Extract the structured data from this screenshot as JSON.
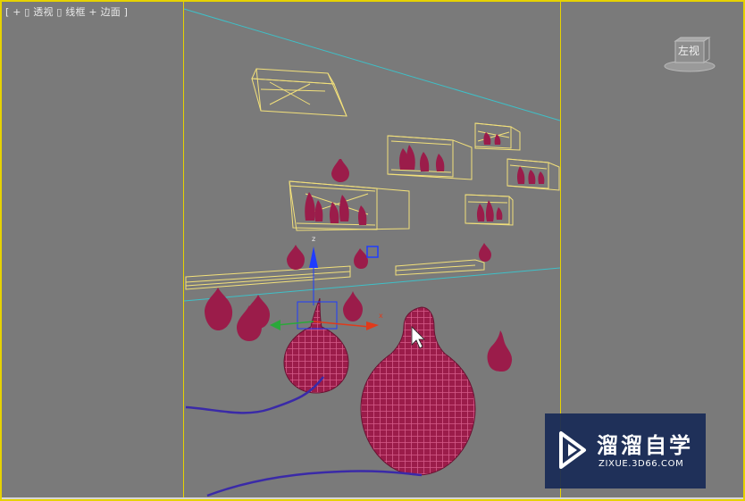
{
  "viewport": {
    "label_parts": [
      "[ + ]",
      "[ 透视 ]",
      "[ 线框 + 边面 ]"
    ],
    "label_text": "[ + ▯ 透视 ▯ 线框 + 边面 ]",
    "active_border_color": "#e6d200"
  },
  "viewcube": {
    "label": "左视",
    "icon": "viewcube-icon"
  },
  "gizmo": {
    "axis_x": "x",
    "axis_z": "z",
    "colors": {
      "x": "#e03a1a",
      "y": "#2aa83a",
      "z": "#1f3cff"
    }
  },
  "colors": {
    "vase": "#9b1c4a",
    "vase_wire": "#c44878",
    "shelf_wire": "#f2e07a",
    "spline": "#3a2aa8",
    "grid_line": "#3ec0c8"
  },
  "watermark": {
    "title": "溜溜自学",
    "url": "ZIXUE.3D66.COM",
    "icon": "play-logo-icon"
  }
}
